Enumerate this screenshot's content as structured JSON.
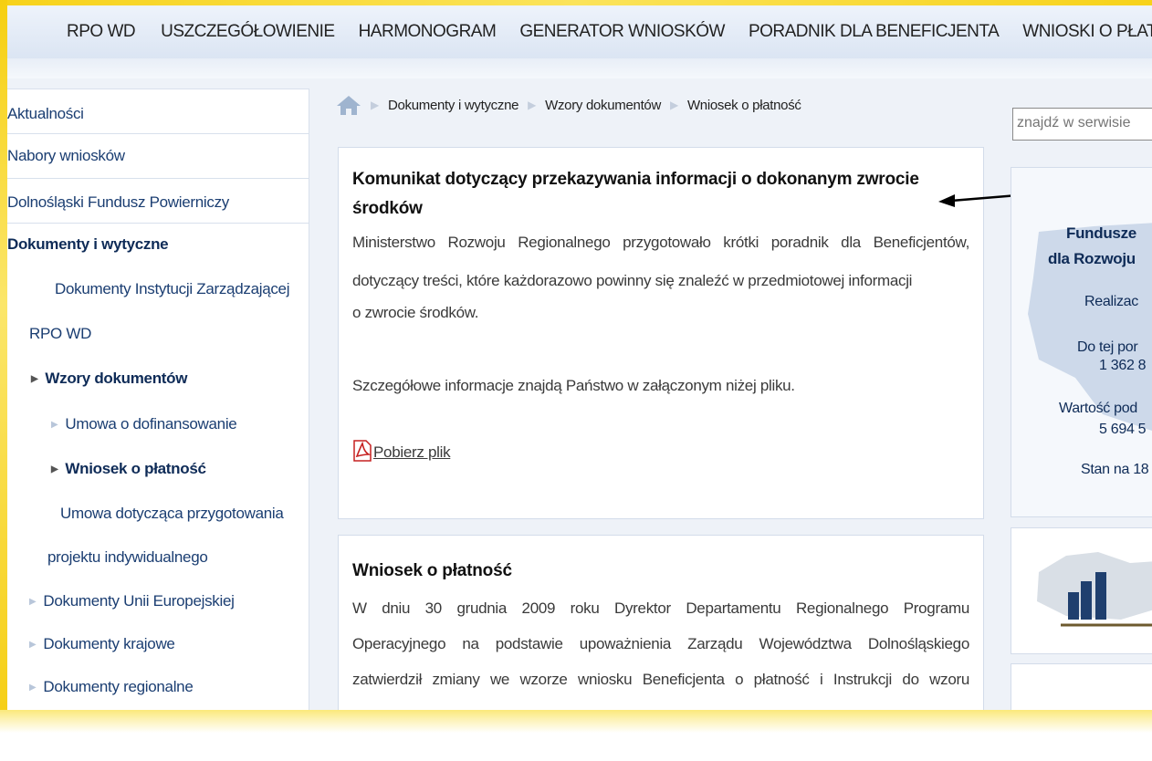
{
  "nav": {
    "items": [
      "RPO WD",
      "USZCZEGÓŁOWIENIE",
      "HARMONOGRAM",
      "GENERATOR WNIOSKÓW",
      "PORADNIK DLA BENEFICJENTA",
      "WNIOSKI O PŁATNOŚ"
    ]
  },
  "sidebar": {
    "items": [
      "Aktualności",
      "Nabory wniosków",
      "Dolnośląski Fundusz Powierniczy",
      "Dokumenty i wytyczne",
      "Dokumenty Instytucji Zarządzającej",
      "RPO WD",
      "Wzory dokumentów",
      "Umowa o dofinansowanie",
      "Wniosek o płatność",
      "Umowa dotycząca przygotowania",
      "projektu indywidualnego",
      "Dokumenty Unii Europejskiej",
      "Dokumenty krajowe",
      "Dokumenty regionalne"
    ]
  },
  "breadcrumb": {
    "items": [
      "Dokumenty i wytyczne",
      "Wzory dokumentów",
      "Wniosek o płatność"
    ]
  },
  "article1": {
    "title_line1": "Komunikat dotyczący przekazywania informacji o dokonanym zwrocie",
    "title_line2": "środków",
    "p1_line1": "Ministerstwo Rozwoju Regionalnego przygotowało krótki poradnik dla Beneficjentów,",
    "p1_line2": "dotyczący treści, które każdorazowo powinny się znaleźć w przedmiotowej informacji",
    "p1_line3": "o zwrocie środków.",
    "p2": "Szczegółowe informacje znajdą Państwo w załączonym niżej pliku.",
    "download_label": "Pobierz plik"
  },
  "article2": {
    "title": "Wniosek o płatność",
    "line1": "W dniu 30 grudnia 2009 roku Dyrektor Departamentu Regionalnego Programu",
    "line2": "Operacyjnego na podstawie upoważnienia Zarządu Województwa Dolnośląskiego",
    "line3": "zatwierdził zmiany we wzorze wniosku Beneficjenta o płatność i Instrukcji do wzoru"
  },
  "search": {
    "placeholder": "znajdź w serwisie"
  },
  "funds_box": {
    "line1": "Fundusze",
    "line2": "dla Rozwoju",
    "line3": "Realizac",
    "line4": "Do tej por",
    "line5": "1 362 8",
    "line6": "Wartość pod",
    "line7": "5 694 5",
    "line8": "Stan na 18"
  },
  "colors": {
    "frame": "#f6cf10",
    "nav_bg": "#dbe5f3",
    "link": "#1b3e72",
    "map": "#c5d3e6",
    "bars": "#1f3f6e",
    "arrow": "#000000"
  }
}
